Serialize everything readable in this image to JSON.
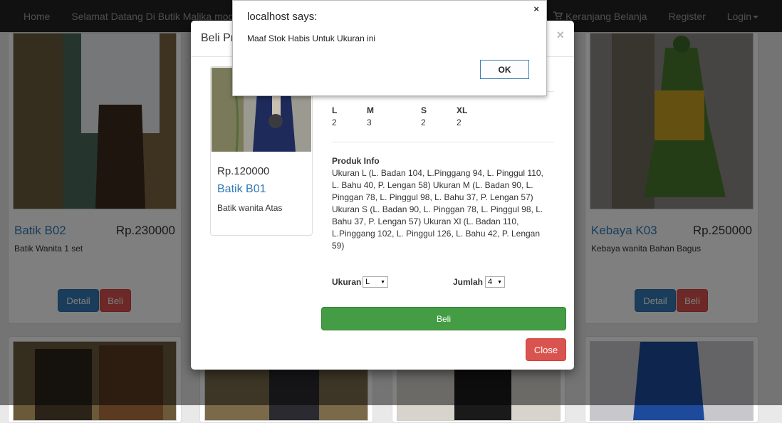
{
  "navbar": {
    "home": "Home",
    "welcome": "Selamat Datang Di Butik Malika mode",
    "cart": "Keranjang Belanja",
    "register": "Register",
    "login": "Login"
  },
  "products": [
    {
      "name": "Batik B02",
      "price": "Rp.230000",
      "desc": "Batik Wanita 1 set",
      "detail_label": "Detail",
      "buy_label": "Beli"
    },
    {
      "name": "Kebaya K03",
      "price": "Rp.250000",
      "desc": "Kebaya wanita Bahan Bagus",
      "detail_label": "Detail",
      "buy_label": "Beli"
    }
  ],
  "modal": {
    "title": "Beli Pr",
    "close_x": "×",
    "product": {
      "price": "Rp.120000",
      "name": "Batik B01",
      "desc": "Batik wanita Atas"
    },
    "stock": [
      {
        "size": "L",
        "qty": "2"
      },
      {
        "size": "M",
        "qty": "3"
      },
      {
        "size": "S",
        "qty": "2"
      },
      {
        "size": "XL",
        "qty": "2"
      }
    ],
    "info_title": "Produk Info",
    "info_text": "Ukuran L (L. Badan 104, L.Pinggang 94, L. Pinggul 110, L. Bahu 40, P. Lengan 58) Ukuran M (L. Badan 90, L. Pinggan 78, L. Pinggul 98, L. Bahu 37, P. Lengan 57) Ukuran S (L. Badan 90, L. Pinggan 78, L. Pinggul 98, L. Bahu 37, P. Lengan 57) Ukuran Xl (L. Badan 110, L.Pinggang 102, L. Pinggul 126, L. Bahu 42, P. Lengan 59)",
    "size_label": "Ukuran",
    "size_value": "L",
    "qty_label": "Jumlah",
    "qty_value": "4",
    "buy_label": "Beli",
    "close_label": "Close"
  },
  "alert": {
    "title": "localhost says:",
    "close": "×",
    "message": "Maaf Stok Habis Untuk Ukuran ini",
    "ok_label": "OK"
  },
  "colors": {
    "navbar": "#222222",
    "primary": "#337ab7",
    "danger": "#d9534f",
    "success": "#449d44"
  }
}
